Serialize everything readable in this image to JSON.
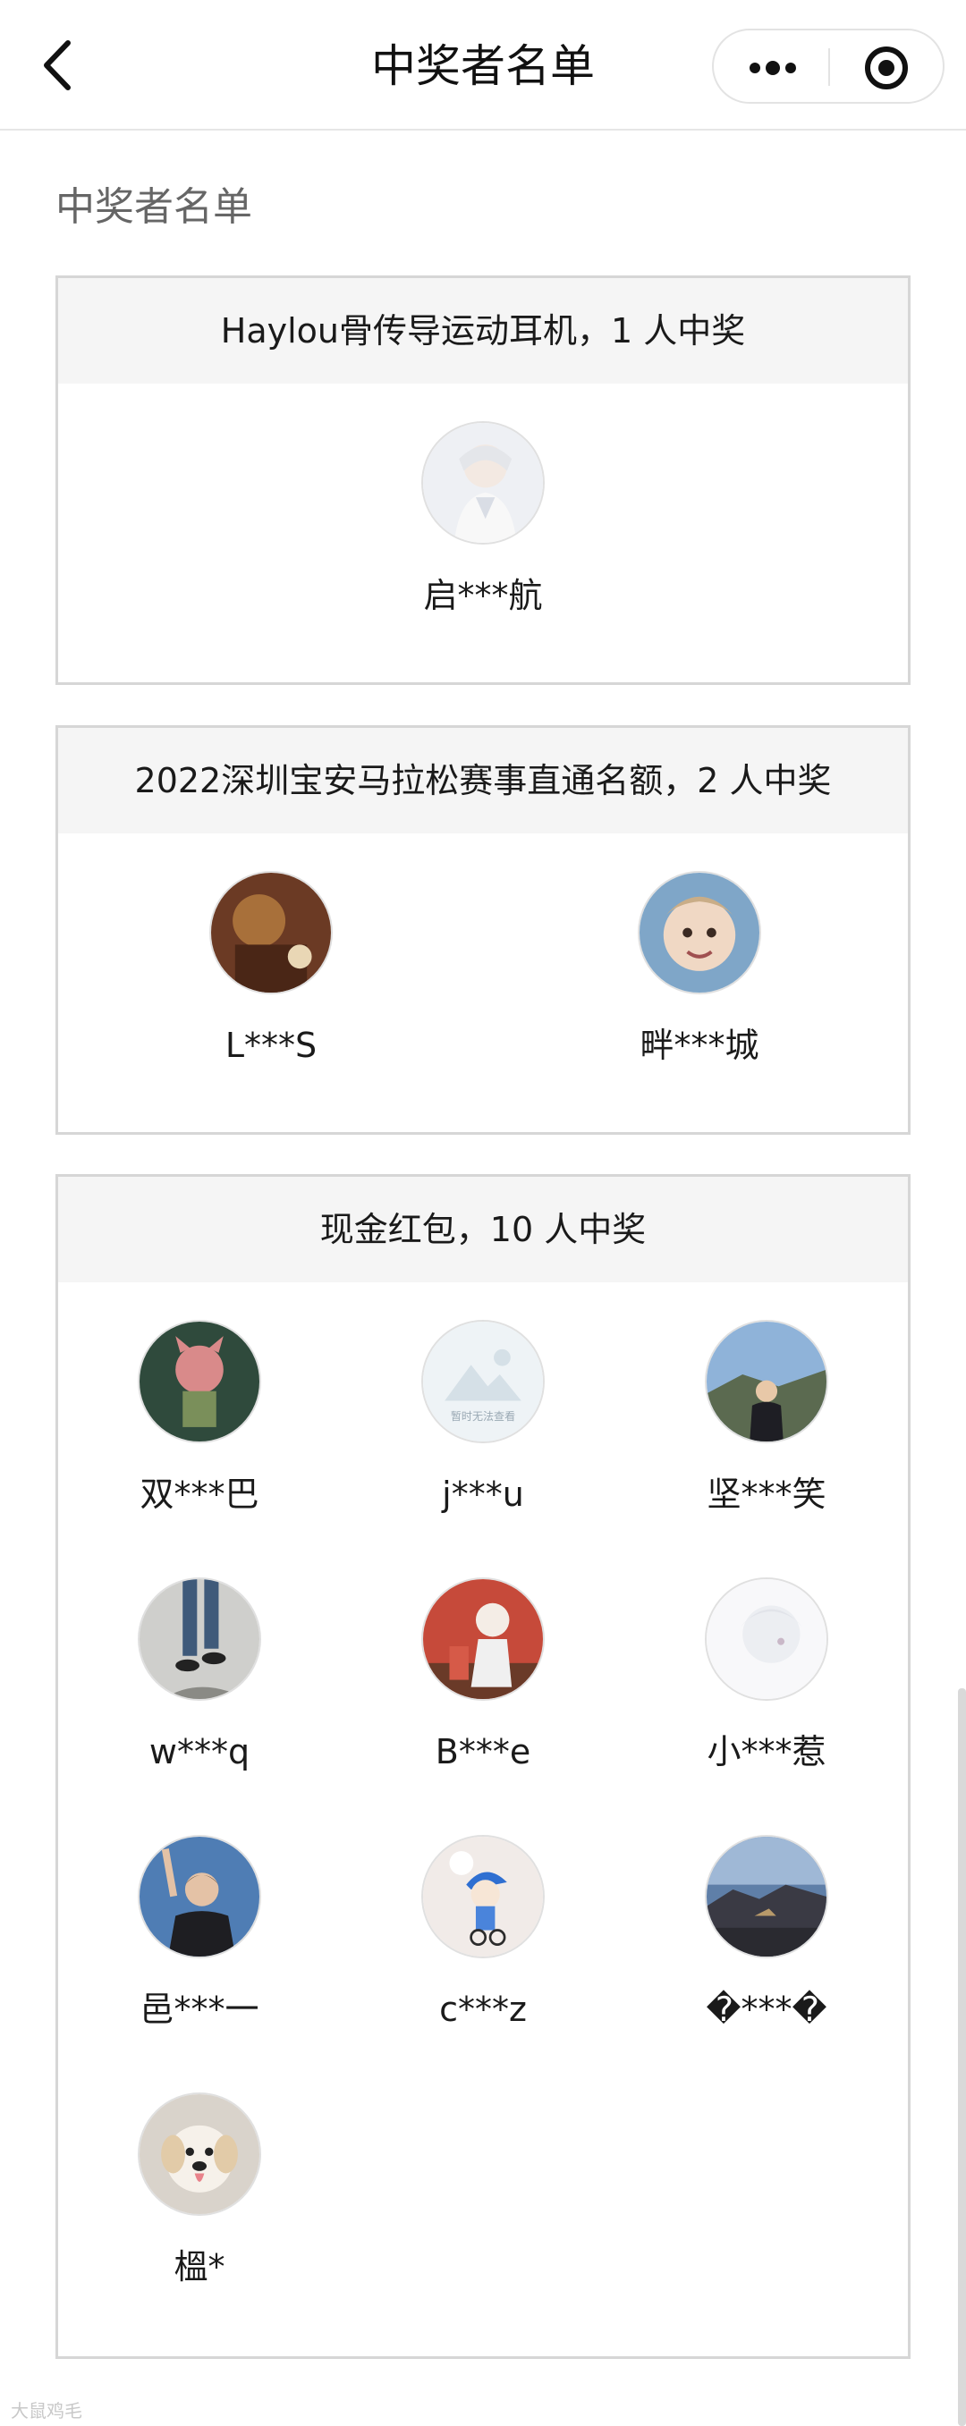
{
  "nav": {
    "title": "中奖者名单"
  },
  "section": {
    "title": "中奖者名单"
  },
  "prizes": [
    {
      "header": "Haylou骨传导运动耳机，1 人中奖",
      "winners": [
        "启***航"
      ]
    },
    {
      "header": "2022深圳宝安马拉松赛事直通名额，2 人中奖",
      "winners": [
        "L***S",
        "畔***城"
      ]
    },
    {
      "header": "现金红包，10 人中奖",
      "winners": [
        "双***巴",
        "j***u",
        "坚***笑",
        "w***q",
        "B***e",
        "小***惹",
        "邑***一",
        "c***z",
        "�***�",
        "榲*"
      ]
    }
  ],
  "placeholder_avatar_text": "暂时无法查看",
  "watermark": "大鼠鸡毛",
  "icons": {
    "back": "chevron-left-icon",
    "more": "more-dots-icon",
    "close": "target-circle-icon"
  },
  "colors": {
    "header_bg": "#f5f5f5",
    "border": "#d6d6d6",
    "text": "#1a1a1a",
    "muted": "#666666"
  }
}
